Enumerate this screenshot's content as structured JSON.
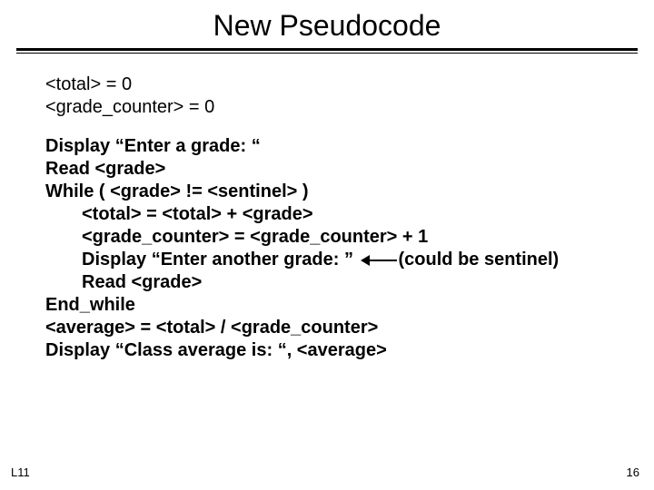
{
  "title": "New Pseudocode",
  "init": {
    "line1": "<total> = 0",
    "line2": "<grade_counter> = 0"
  },
  "code": {
    "l1": "Display “Enter a grade: “",
    "l2": "Read <grade>",
    "l3": "While  ( <grade>  !=  <sentinel> )",
    "l4": "<total> = <total> + <grade>",
    "l5": "<grade_counter> = <grade_counter> + 1",
    "l6a": "Display “Enter another grade: ” ",
    "l6b": "(could be sentinel)",
    "l7": "Read <grade>",
    "l8": "End_while",
    "l9": "<average> = <total> / <grade_counter>",
    "l10": "Display “Class average is: “, <average>"
  },
  "footer": {
    "left": "L11",
    "right": "16"
  }
}
